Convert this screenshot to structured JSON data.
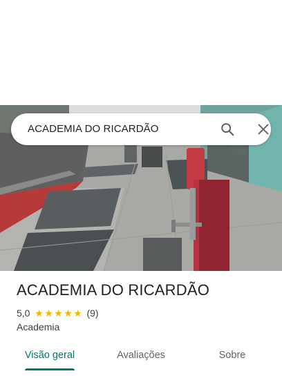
{
  "search": {
    "query": "ACADEMIA DO RICARDÃO",
    "search_icon": "search-icon",
    "close_icon": "close-icon"
  },
  "place": {
    "title": "ACADEMIA DO RICARDÃO",
    "rating": "5,0",
    "stars": [
      "★",
      "★",
      "★",
      "★",
      "★"
    ],
    "reviews": "(9)",
    "category": "Academia"
  },
  "tabs": [
    {
      "label": "Visão geral",
      "active": true
    },
    {
      "label": "Avaliações",
      "active": false
    },
    {
      "label": "Sobre",
      "active": false
    }
  ],
  "colors": {
    "accent": "#00796b",
    "star": "#f4b400"
  }
}
